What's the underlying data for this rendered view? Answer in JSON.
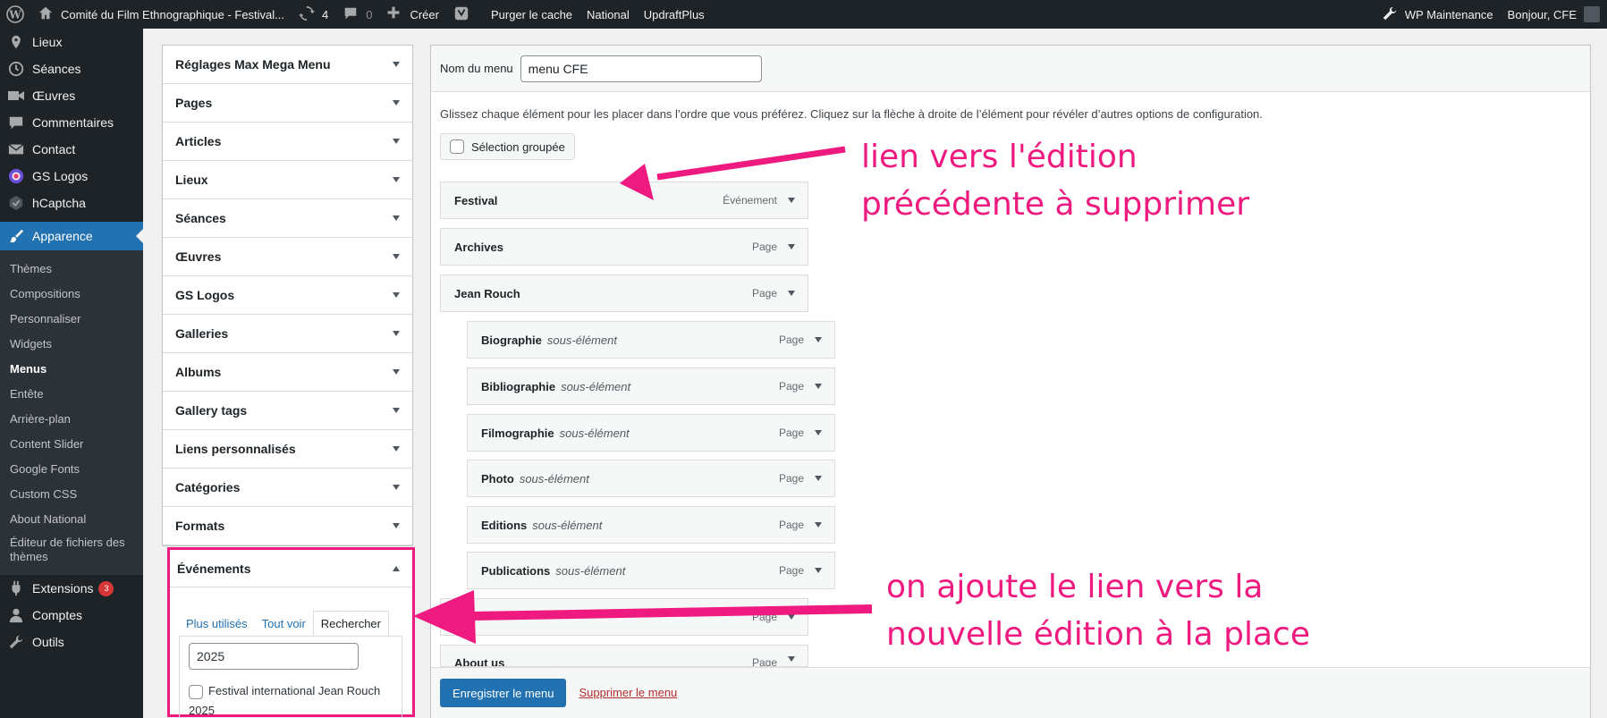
{
  "adminbar": {
    "site_title": "Comité du Film Ethnographique - Festival...",
    "updates_count": "4",
    "comments_count": "0",
    "new_label": "Créer",
    "purge_label": "Purger le cache",
    "national_label": "National",
    "updraft_label": "UpdraftPlus",
    "maintenance_label": "WP Maintenance",
    "greeting": "Bonjour, CFE"
  },
  "sidebar": {
    "top_items": [
      {
        "label": "Lieux",
        "icon": "location-icon"
      },
      {
        "label": "Séances",
        "icon": "clock-icon"
      },
      {
        "label": "Œuvres",
        "icon": "video-icon"
      },
      {
        "label": "Commentaires",
        "icon": "comment-icon"
      },
      {
        "label": "Contact",
        "icon": "mail-icon"
      },
      {
        "label": "GS Logos",
        "icon": "gs-logo-icon"
      },
      {
        "label": "hCaptcha",
        "icon": "hcaptcha-icon"
      }
    ],
    "current": {
      "label": "Apparence",
      "icon": "brush-icon"
    },
    "submenu": [
      "Thèmes",
      "Compositions",
      "Personnaliser",
      "Widgets",
      "Menus",
      "Entête",
      "Arrière-plan",
      "Content Slider",
      "Google Fonts",
      "Custom CSS",
      "About National",
      "Éditeur de fichiers des thèmes"
    ],
    "active_submenu": "Menus",
    "bottom_items": [
      {
        "label": "Extensions",
        "icon": "plugin-icon",
        "badge": "3"
      },
      {
        "label": "Comptes",
        "icon": "user-icon"
      },
      {
        "label": "Outils",
        "icon": "wrench-icon"
      }
    ]
  },
  "accordion": {
    "items": [
      "Réglages Max Mega Menu",
      "Pages",
      "Articles",
      "Lieux",
      "Séances",
      "Œuvres",
      "GS Logos",
      "Galleries",
      "Albums",
      "Gallery tags",
      "Liens personnalisés",
      "Catégories",
      "Formats"
    ],
    "open_item": "Événements",
    "tabs": [
      "Plus utilisés",
      "Tout voir",
      "Rechercher"
    ],
    "active_tab": "Rechercher",
    "search_value": "2025",
    "result_label": "Festival international Jean Rouch 2025"
  },
  "editor": {
    "name_label": "Nom du menu",
    "name_value": "menu CFE",
    "instructions": "Glissez chaque élément pour les placer dans l’ordre que vous préférez. Cliquez sur la flèche à droite de l’élément pour révéler d’autres options de configuration.",
    "bulk_label": "Sélection groupée",
    "items": [
      {
        "title": "Festival",
        "sub": "",
        "type": "Événement"
      },
      {
        "title": "Archives",
        "sub": "",
        "type": "Page"
      },
      {
        "title": "Jean Rouch",
        "sub": "",
        "type": "Page"
      },
      {
        "title": "Biographie",
        "sub": "sous-élément",
        "type": "Page"
      },
      {
        "title": "Bibliographie",
        "sub": "sous-élément",
        "type": "Page"
      },
      {
        "title": "Filmographie",
        "sub": "sous-élément",
        "type": "Page"
      },
      {
        "title": "Photo",
        "sub": "sous-élément",
        "type": "Page"
      },
      {
        "title": "Editions",
        "sub": "sous-élément",
        "type": "Page"
      },
      {
        "title": "Publications",
        "sub": "sous-élément",
        "type": "Page"
      },
      {
        "title": "",
        "sub": "",
        "type": "Page"
      },
      {
        "title": "About us",
        "sub": "",
        "type": "Page"
      }
    ],
    "save_label": "Enregistrer le menu",
    "delete_label": "Supprimer le menu"
  },
  "annotations": {
    "top_line1": "lien vers l'édition",
    "top_line2": "précédente à supprimer",
    "bottom_line1": "on ajoute le lien vers la",
    "bottom_line2": "nouvelle édition à la place",
    "color": "#ee1a7f"
  }
}
